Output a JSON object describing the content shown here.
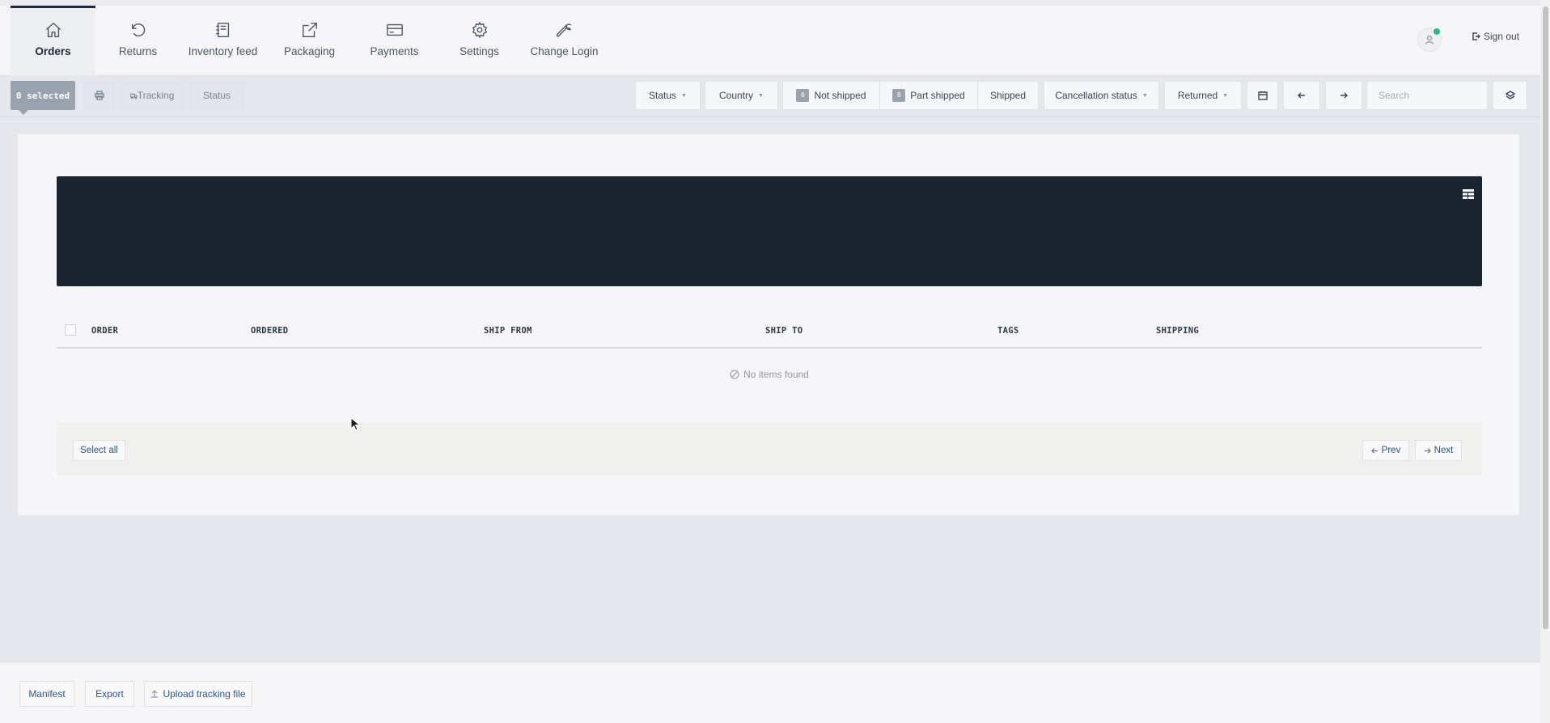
{
  "nav": {
    "items": [
      {
        "label": "Orders",
        "icon": "home-icon",
        "active": true
      },
      {
        "label": "Returns",
        "icon": "undo-icon"
      },
      {
        "label": "Inventory feed",
        "icon": "notebook-icon"
      },
      {
        "label": "Packaging",
        "icon": "external-link-icon"
      },
      {
        "label": "Payments",
        "icon": "credit-card-icon"
      },
      {
        "label": "Settings",
        "icon": "gear-icon"
      },
      {
        "label": "Change Login",
        "icon": "wrench-icon"
      }
    ],
    "signout_label": "Sign out"
  },
  "toolbar": {
    "selected_label": "0 selected",
    "tracking_label": "Tracking",
    "status_label": "Status",
    "filters": {
      "status": "Status",
      "country": "Country",
      "not_shipped": "Not shipped",
      "not_shipped_count": "0",
      "part_shipped": "Part shipped",
      "part_shipped_count": "0",
      "shipped": "Shipped",
      "cancellation_status": "Cancellation status",
      "returned": "Returned"
    },
    "search_placeholder": "Search"
  },
  "table": {
    "columns": [
      "ORDER",
      "ORDERED",
      "SHIP FROM",
      "SHIP TO",
      "TAGS",
      "SHIPPING"
    ],
    "empty_message": "No items found"
  },
  "pager": {
    "select_all_label": "Select all",
    "prev_label": "Prev",
    "next_label": "Next"
  },
  "footer": {
    "manifest_label": "Manifest",
    "export_label": "Export",
    "upload_label": "Upload tracking file"
  },
  "colors": {
    "banner": "#1b2532",
    "active_indicator": "#1e2a3b",
    "online_dot": "#2eb886",
    "link": "#2e5a86"
  }
}
